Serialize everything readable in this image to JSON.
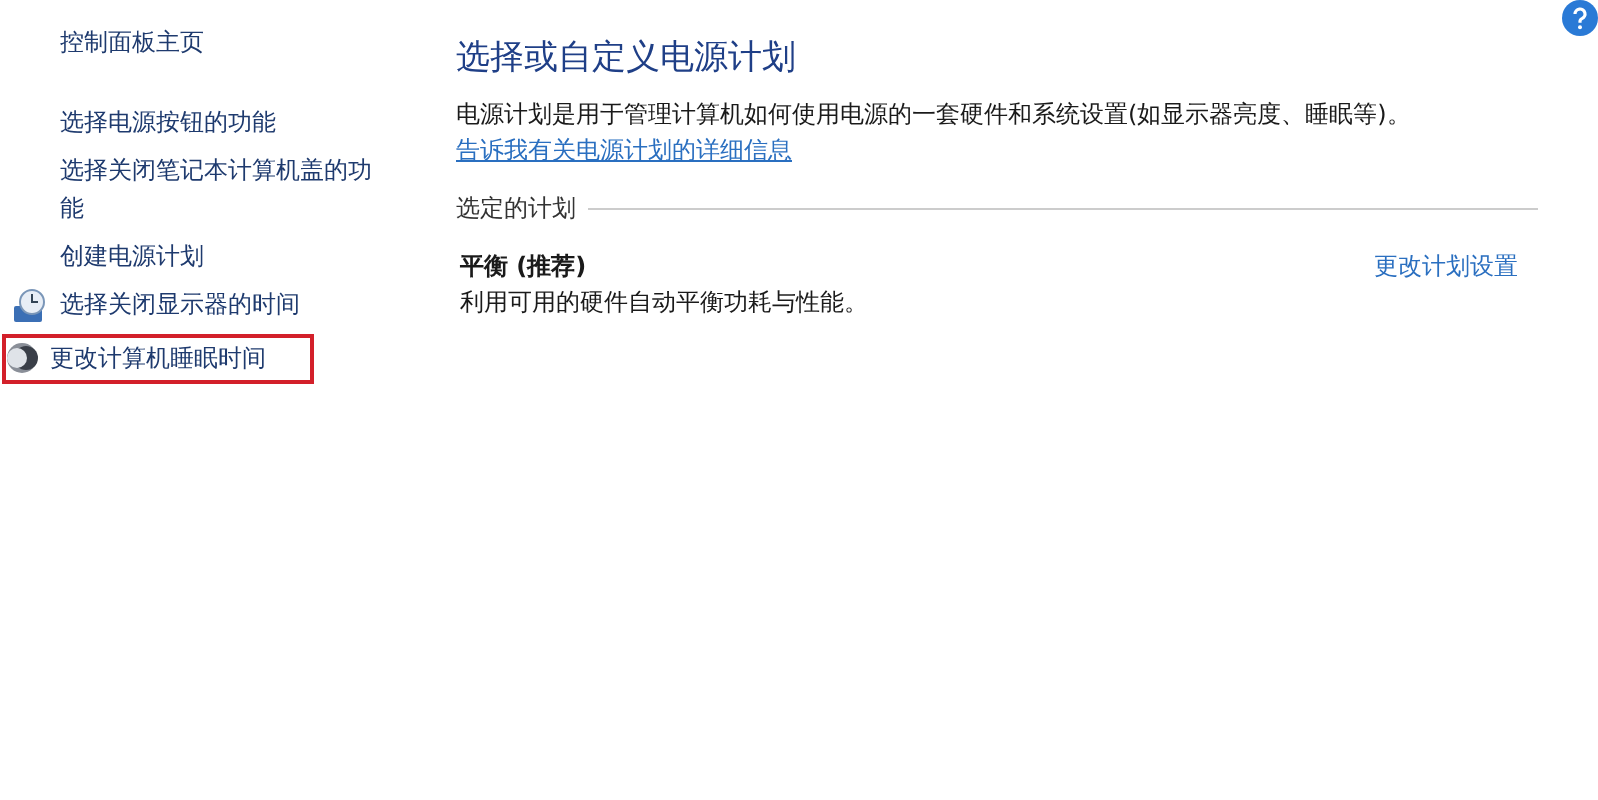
{
  "sidebar": {
    "items": [
      {
        "label": "控制面板主页",
        "kind": "home",
        "highlighted": false
      },
      {
        "label": "选择电源按钮的功能",
        "kind": "link",
        "highlighted": false
      },
      {
        "label": "选择关闭笔记本计算机盖的功能",
        "kind": "link",
        "highlighted": false
      },
      {
        "label": "创建电源计划",
        "kind": "link",
        "highlighted": false
      },
      {
        "label": "选择关闭显示器的时间",
        "kind": "display",
        "highlighted": false
      },
      {
        "label": "更改计算机睡眠时间",
        "kind": "sleep",
        "highlighted": true
      }
    ]
  },
  "main": {
    "title": "选择或自定义电源计划",
    "description": "电源计划是用于管理计算机如何使用电源的一套硬件和系统设置(如显示器亮度、睡眠等)。",
    "description_link": "告诉我有关电源计划的详细信息",
    "section_label": "选定的计划",
    "plan": {
      "name": "平衡 (推荐)",
      "description": "利用可用的硬件自动平衡功耗与性能。",
      "settings_link": "更改计划设置"
    }
  }
}
